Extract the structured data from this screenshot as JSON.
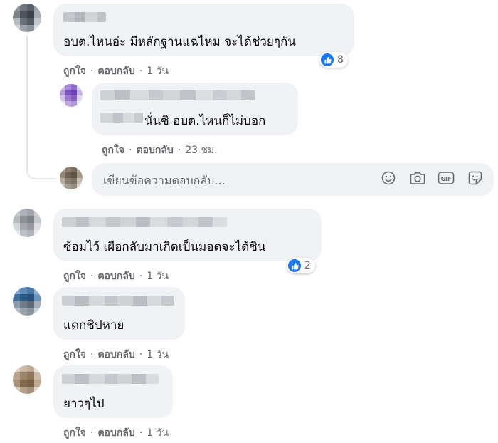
{
  "comments": [
    {
      "text": "อบต.ไหนอ่ะ มีหลักฐานแฉไหม จะได้ช่วยๆกัน",
      "like_label": "ถูกใจ",
      "reply_label": "ตอบกลับ",
      "separator": "·",
      "time": "1 วัน",
      "reaction_count": "8",
      "reply": {
        "text": "นั่นซิ อบต.ไหนก็ไม่บอก",
        "like_label": "ถูกใจ",
        "reply_label": "ตอบกลับ",
        "separator": "·",
        "time": "23 ชม."
      }
    },
    {
      "text": "ซ้อมไว้ เผือกลับมาเกิดเป็นมอดจะได้ชิน",
      "like_label": "ถูกใจ",
      "reply_label": "ตอบกลับ",
      "separator": "·",
      "time": "1 วัน",
      "reaction_count": "2"
    },
    {
      "text": "แดกชิปหาย",
      "like_label": "ถูกใจ",
      "reply_label": "ตอบกลับ",
      "separator": "·",
      "time": "1 วัน"
    },
    {
      "text": "ยาวๆไป",
      "like_label": "ถูกใจ",
      "reply_label": "ตอบกลับ",
      "separator": "·",
      "time": "1 วัน"
    }
  ],
  "reply_input": {
    "placeholder": "เขียนข้อความตอบกลับ...",
    "tools": [
      "emoji-icon",
      "camera-icon",
      "gif-icon",
      "sticker-icon"
    ]
  },
  "colors": {
    "bubble": "#f0f2f5",
    "meta": "#65676b",
    "like_blue": "#1877f2"
  }
}
